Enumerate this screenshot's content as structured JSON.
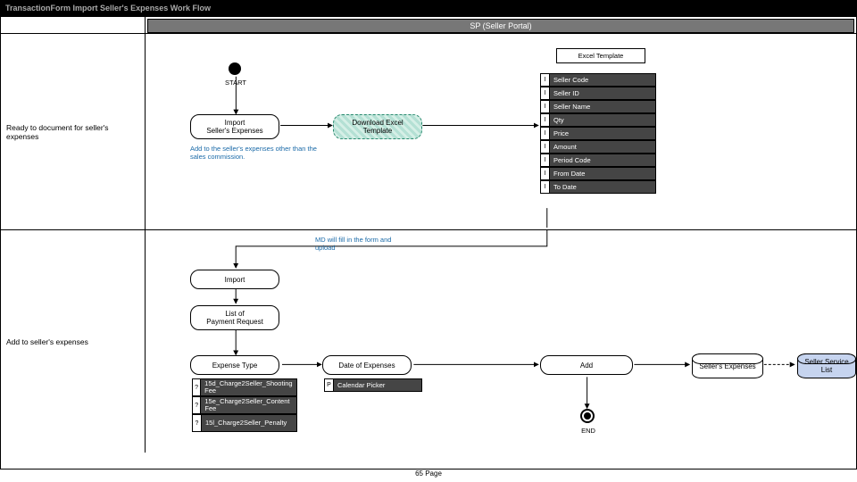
{
  "title": "TransactionForm Import Seller's Expenses Work Flow",
  "swimlane_header": "SP (Seller Portal)",
  "row1_label": "Ready to document for seller's expenses",
  "row2_label": "Add to seller's expenses",
  "start_label": "START",
  "end_label": "END",
  "import_expenses": "Import\nSeller's Expenses",
  "download_template": "Download Excel Template",
  "annot1": "Add to the seller's expenses other than the sales commission.",
  "excel_template_title": "Excel Template",
  "excel_fields": [
    "Seller Code",
    "Seller ID",
    "Seller Name",
    "Qty",
    "Price",
    "Amount",
    "Period Code",
    "From Date",
    "To Date"
  ],
  "field_tag": "I",
  "annot2": "MD will fill in the form and upload",
  "import_btn": "Import",
  "list_payment": "List of\nPayment Request",
  "expense_type": "Expense Type",
  "expense_items": [
    "15d_Charge2Seller_Shooting Fee",
    "15e_Charge2Seller_Content Fee",
    "15l_Charge2Seller_Penalty"
  ],
  "expense_tag": "?",
  "date_of_expenses": "Date of Expenses",
  "calendar_picker": "Calendar Picker",
  "calendar_tag": "P",
  "add_btn": "Add",
  "sellers_expenses": "Seller's Expenses",
  "seller_service_list": "Seller Service List",
  "page_footer": "65 Page"
}
